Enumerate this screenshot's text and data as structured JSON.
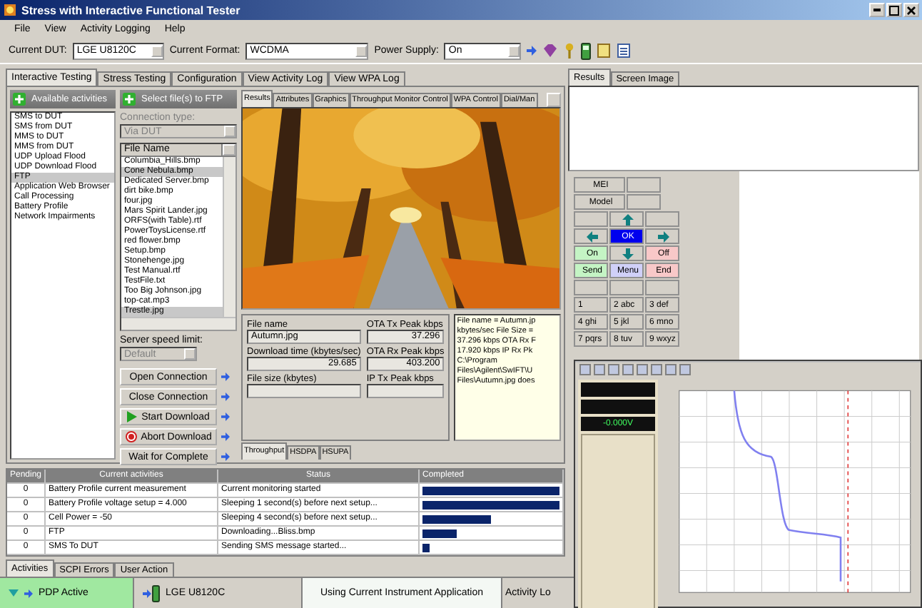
{
  "window": {
    "title": "Stress with Interactive Functional Tester"
  },
  "menu": [
    "File",
    "View",
    "Activity Logging",
    "Help"
  ],
  "toolbar": {
    "dut_label": "Current DUT:",
    "dut": "LGE U8120C",
    "format_label": "Current Format:",
    "format": "WCDMA",
    "power_label": "Power Supply:",
    "power": "On"
  },
  "main_tabs": [
    {
      "label": "Interactive Testing",
      "selected": true
    },
    {
      "label": "Stress Testing",
      "selected": false
    },
    {
      "label": "Configuration",
      "selected": false
    },
    {
      "label": "View Activity Log",
      "selected": false
    },
    {
      "label": "View WPA Log",
      "selected": false
    }
  ],
  "activities": {
    "header": "Available activities",
    "items": [
      {
        "label": "SMS to DUT",
        "selected": false
      },
      {
        "label": "SMS from DUT",
        "selected": false
      },
      {
        "label": "MMS to DUT",
        "selected": false
      },
      {
        "label": "MMS from DUT",
        "selected": false
      },
      {
        "label": "UDP Upload Flood",
        "selected": false
      },
      {
        "label": "UDP Download Flood",
        "selected": false
      },
      {
        "label": "FTP",
        "selected": true
      },
      {
        "label": "Application Web Browser",
        "selected": false
      },
      {
        "label": "Call Processing",
        "selected": false
      },
      {
        "label": "Battery Profile",
        "selected": false
      },
      {
        "label": "Network Impairments",
        "selected": false
      }
    ]
  },
  "ftp": {
    "header": "Select file(s) to FTP",
    "connection_label": "Connection type:",
    "connection": "Via DUT",
    "file_header": "File Name",
    "files": [
      {
        "name": "Columbia_Hills.bmp",
        "selected": false
      },
      {
        "name": "Cone Nebula.bmp",
        "selected": true
      },
      {
        "name": "Dedicated Server.bmp",
        "selected": false
      },
      {
        "name": "dirt bike.bmp",
        "selected": false
      },
      {
        "name": "four.jpg",
        "selected": false
      },
      {
        "name": "Mars Spirit Lander.jpg",
        "selected": false
      },
      {
        "name": "ORFS(with Table).rtf",
        "selected": false
      },
      {
        "name": "PowerToysLicense.rtf",
        "selected": false
      },
      {
        "name": "red flower.bmp",
        "selected": false
      },
      {
        "name": "Setup.bmp",
        "selected": false
      },
      {
        "name": "Stonehenge.jpg",
        "selected": false
      },
      {
        "name": "Test Manual.rtf",
        "selected": false
      },
      {
        "name": "TestFile.txt",
        "selected": false
      },
      {
        "name": "Too Big Johnson.jpg",
        "selected": false
      },
      {
        "name": "top-cat.mp3",
        "selected": false
      },
      {
        "name": "Trestle.jpg",
        "selected": true
      }
    ],
    "speed_label": "Server speed limit:",
    "speed": "Default",
    "buttons": [
      {
        "label": "Open Connection",
        "kind": "plain"
      },
      {
        "label": "Close Connection",
        "kind": "plain"
      },
      {
        "label": "Start Download",
        "kind": "start"
      },
      {
        "label": "Abort Download",
        "kind": "abort"
      },
      {
        "label": "Wait for Complete",
        "kind": "plain"
      }
    ]
  },
  "results": {
    "tabs": [
      {
        "label": "Results",
        "selected": true
      },
      {
        "label": "Attributes",
        "selected": false
      },
      {
        "label": "Graphics",
        "selected": false
      },
      {
        "label": "Throughput Monitor Control",
        "selected": false
      },
      {
        "label": "WPA Control",
        "selected": false
      },
      {
        "label": "Dial/Man",
        "selected": false
      }
    ],
    "fields": [
      {
        "label": "File name",
        "value": "Autumn.jpg"
      },
      {
        "label": "OTA Tx Peak kbps",
        "value": "37.296"
      },
      {
        "label": "Download time (kbytes/sec)",
        "value": "29.685"
      },
      {
        "label": "OTA Rx Peak kbps",
        "value": "403.200"
      },
      {
        "label": "File size (kbytes)"
      },
      {
        "label": "IP Tx Peak kbps"
      }
    ],
    "log": [
      "File name = Autumn.jp",
      "kbytes/sec File Size =",
      "37.296 kbps OTA Rx F",
      "17.920 kbps IP Rx Pk",
      "C:\\Program",
      "Files\\Agilent\\SwIFT\\U",
      "Files\\Autumn.jpg does"
    ],
    "sub_tabs": [
      {
        "label": "Throughput",
        "selected": true
      },
      {
        "label": "HSDPA",
        "selected": false
      },
      {
        "label": "HSUPA",
        "selected": false
      }
    ]
  },
  "activity_table": {
    "columns": [
      "Pending",
      "Current activities",
      "Status",
      "Completed"
    ],
    "rows": [
      {
        "pending": "0",
        "activity": "Battery Profile current measurement",
        "status": "Current monitoring started",
        "level": 1
      },
      {
        "pending": "0",
        "activity": "Battery Profile voltage setup = 4.000",
        "status": "Sleeping 1 second(s) before next setup...",
        "level": 1
      },
      {
        "pending": "0",
        "activity": "Cell Power = -50",
        "status": "Sleeping 4 second(s) before next setup...",
        "level": 0.5
      },
      {
        "pending": "0",
        "activity": "FTP",
        "status": "Downloading...Bliss.bmp",
        "level": 0.25
      },
      {
        "pending": "0",
        "activity": "SMS To DUT",
        "status": "Sending SMS message started...",
        "level": 0.05
      }
    ]
  },
  "bottom_tabs": [
    {
      "label": "Activities",
      "selected": true
    },
    {
      "label": "SCPI Errors",
      "selected": false
    },
    {
      "label": "User Action",
      "selected": false
    }
  ],
  "right_panel": {
    "tabs": [
      {
        "label": "Results",
        "selected": true
      },
      {
        "label": "Screen Image",
        "selected": false
      }
    ],
    "keypad": [
      [
        {
          "kind": "text",
          "label": "MEI",
          "color": "#d4d0c8"
        },
        {
          "kind": "blank"
        }
      ],
      [
        {
          "kind": "text",
          "label": "Model",
          "color": "#d4d0c8"
        },
        {
          "kind": "blank"
        }
      ],
      [
        {
          "kind": "blank"
        },
        {
          "kind": "up"
        },
        {
          "kind": "blank"
        }
      ],
      [
        {
          "kind": "left"
        },
        {
          "kind": "text",
          "label": "OK",
          "color": "#0000ee"
        },
        {
          "kind": "right"
        }
      ],
      [
        {
          "kind": "text",
          "label": "On",
          "color": "#c4f4c4"
        },
        {
          "kind": "down"
        },
        {
          "kind": "text",
          "label": "Off",
          "color": "#f8c8c8"
        }
      ],
      [
        {
          "kind": "text",
          "label": "Send",
          "color": "#c4f4c4"
        },
        {
          "kind": "text",
          "label": "Menu",
          "color": "#d0d0f8"
        },
        {
          "kind": "text",
          "label": "End",
          "color": "#f8c8c8"
        }
      ],
      [
        {
          "kind": "blank"
        },
        {
          "kind": "blank"
        },
        {
          "kind": "blank"
        }
      ],
      [
        {
          "kind": "text",
          "label": "1",
          "color": "#d4d0c8"
        },
        {
          "kind": "text",
          "label": "2 abc",
          "color": "#d4d0c8"
        },
        {
          "kind": "text",
          "label": "3 def",
          "color": "#d4d0c8"
        }
      ],
      [
        {
          "kind": "text",
          "label": "4 ghi",
          "color": "#d4d0c8"
        },
        {
          "kind": "text",
          "label": "5 jkl",
          "color": "#d4d0c8"
        },
        {
          "kind": "text",
          "label": "6 mno",
          "color": "#d4d0c8"
        }
      ],
      [
        {
          "kind": "text",
          "label": "7 pqrs",
          "color": "#d4d0c8"
        },
        {
          "kind": "text",
          "label": "8 tuv",
          "color": "#d4d0c8"
        },
        {
          "kind": "text",
          "label": "9 wxyz",
          "color": "#d4d0c8"
        }
      ]
    ]
  },
  "status_bar": {
    "pdp": "PDP Active",
    "device": "LGE U8120C",
    "application": "Using Current Instrument Application",
    "log": "Activity Lo"
  },
  "overlay_window": {
    "readout": "-0.000V"
  }
}
